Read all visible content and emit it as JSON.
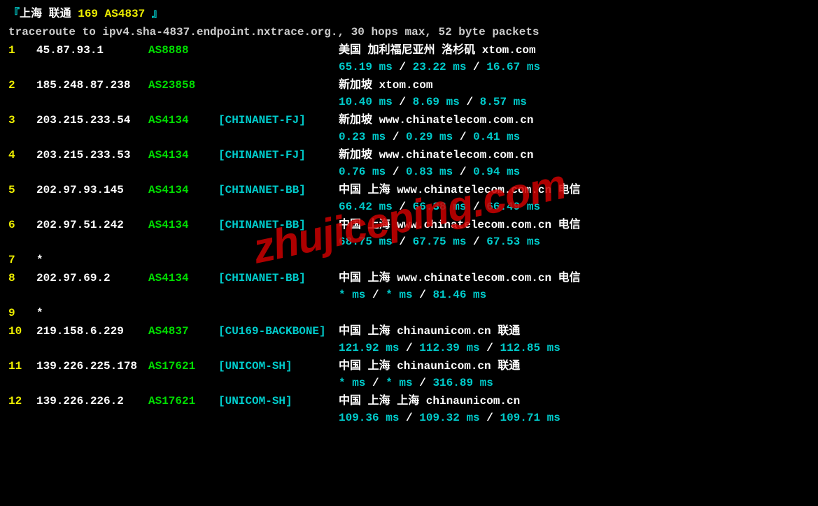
{
  "header": {
    "bracket_open": "『",
    "location": "上海  联通",
    "asn_info": "  169 AS4837",
    "bracket_close": " 』"
  },
  "cmd": "traceroute to ipv4.sha-4837.endpoint.nxtrace.org., 30 hops max, 52 byte packets",
  "watermark": "zhujiceping.com",
  "hops": [
    {
      "num": "1",
      "ip": "45.87.93.1",
      "asn": "AS8888",
      "tag": "",
      "geo": "美国  加利福尼亚州  洛杉矶   xtom.com",
      "rtt1": "65.19 ms",
      "rtt2": "23.22 ms",
      "rtt3": "16.67 ms",
      "has_rtt": true
    },
    {
      "num": "2",
      "ip": "185.248.87.238",
      "asn": "AS23858",
      "tag": "",
      "geo": "新加坡    xtom.com",
      "rtt1": "10.40 ms",
      "rtt2": "8.69 ms",
      "rtt3": "8.57 ms",
      "has_rtt": true
    },
    {
      "num": "3",
      "ip": "203.215.233.54",
      "asn": "AS4134",
      "tag": "[CHINANET-FJ]",
      "geo": "新加坡    www.chinatelecom.com.cn",
      "rtt1": "0.23 ms",
      "rtt2": "0.29 ms",
      "rtt3": "0.41 ms",
      "has_rtt": true
    },
    {
      "num": "4",
      "ip": "203.215.233.53",
      "asn": "AS4134",
      "tag": "[CHINANET-FJ]",
      "geo": "新加坡    www.chinatelecom.com.cn",
      "rtt1": "0.76 ms",
      "rtt2": "0.83 ms",
      "rtt3": "0.94 ms",
      "has_rtt": true
    },
    {
      "num": "5",
      "ip": "202.97.93.145",
      "asn": "AS4134",
      "tag": "[CHINANET-BB]",
      "geo": "中国  上海   www.chinatelecom.com.cn  电信",
      "rtt1": "66.42 ms",
      "rtt2": "66.38 ms",
      "rtt3": "66.49 ms",
      "has_rtt": true
    },
    {
      "num": "6",
      "ip": "202.97.51.242",
      "asn": "AS4134",
      "tag": "[CHINANET-BB]",
      "geo": "中国  上海   www.chinatelecom.com.cn  电信",
      "rtt1": "68.75 ms",
      "rtt2": "67.75 ms",
      "rtt3": "67.53 ms",
      "has_rtt": true
    },
    {
      "num": "7",
      "ip": "*",
      "asn": "",
      "tag": "",
      "geo": "",
      "has_rtt": false
    },
    {
      "num": "8",
      "ip": "202.97.69.2",
      "asn": "AS4134",
      "tag": "[CHINANET-BB]",
      "geo": "中国  上海   www.chinatelecom.com.cn  电信",
      "rtt1": "* ms",
      "rtt2": "* ms",
      "rtt3": "81.46 ms",
      "has_rtt": true
    },
    {
      "num": "9",
      "ip": "*",
      "asn": "",
      "tag": "",
      "geo": "",
      "has_rtt": false
    },
    {
      "num": "10",
      "ip": "219.158.6.229",
      "asn": "AS4837",
      "tag": "[CU169-BACKBONE]",
      "geo": "中国  上海   chinaunicom.cn  联通",
      "rtt1": "121.92 ms",
      "rtt2": "112.39 ms",
      "rtt3": "112.85 ms",
      "has_rtt": true
    },
    {
      "num": "11",
      "ip": "139.226.225.178",
      "asn": "AS17621",
      "tag": "[UNICOM-SH]",
      "geo": "中国  上海   chinaunicom.cn  联通",
      "rtt1": "* ms",
      "rtt2": "* ms",
      "rtt3": "316.89 ms",
      "has_rtt": true
    },
    {
      "num": "12",
      "ip": "139.226.226.2",
      "asn": "AS17621",
      "tag": "[UNICOM-SH]",
      "geo": "中国  上海  上海   chinaunicom.cn",
      "rtt1": "109.36 ms",
      "rtt2": "109.32 ms",
      "rtt3": "109.71 ms",
      "has_rtt": true
    }
  ],
  "sep": " / "
}
